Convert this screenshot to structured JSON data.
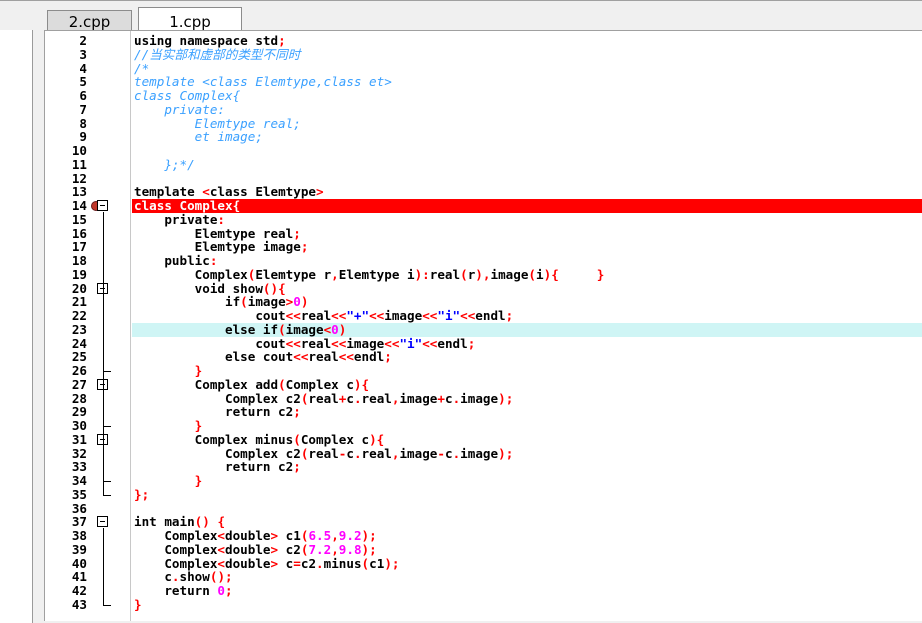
{
  "tabs": [
    {
      "label": "2.cpp",
      "active": false
    },
    {
      "label": "1.cpp",
      "active": true
    }
  ],
  "colors": {
    "error_line": "#ff0000",
    "current_line": "#cff5f5",
    "comment": "#3aa0ff",
    "operator": "#ff0000",
    "string": "#0000ff",
    "number": "#ff00ff"
  },
  "lines": [
    {
      "n": "2",
      "code": "using namespace std;"
    },
    {
      "n": "3",
      "code": "//当实部和虚部的类型不同时"
    },
    {
      "n": "4",
      "code": "/*"
    },
    {
      "n": "5",
      "code": "template <class Elemtype,class et>"
    },
    {
      "n": "6",
      "code": "class Complex{"
    },
    {
      "n": "7",
      "code": "    private:"
    },
    {
      "n": "8",
      "code": "        Elemtype real;"
    },
    {
      "n": "9",
      "code": "        et image;"
    },
    {
      "n": "10",
      "code": ""
    },
    {
      "n": "11",
      "code": "    };*/"
    },
    {
      "n": "12",
      "code": ""
    },
    {
      "n": "13",
      "code": "template <class Elemtype>"
    },
    {
      "n": "14",
      "code": "class Complex{"
    },
    {
      "n": "15",
      "code": "    private:"
    },
    {
      "n": "16",
      "code": "        Elemtype real;"
    },
    {
      "n": "17",
      "code": "        Elemtype image;"
    },
    {
      "n": "18",
      "code": "    public:"
    },
    {
      "n": "19",
      "code": "        Complex(Elemtype r,Elemtype i):real(r),image(i){     }"
    },
    {
      "n": "20",
      "code": "        void show(){"
    },
    {
      "n": "21",
      "code": "            if(image>0)"
    },
    {
      "n": "22",
      "code": "                cout<<real<<\"+\"<<image<<\"i\"<<endl;"
    },
    {
      "n": "23",
      "code": "            else if(image<0)"
    },
    {
      "n": "24",
      "code": "                cout<<real<<image<<\"i\"<<endl;"
    },
    {
      "n": "25",
      "code": "            else cout<<real<<endl;"
    },
    {
      "n": "26",
      "code": "        }"
    },
    {
      "n": "27",
      "code": "        Complex add(Complex c){"
    },
    {
      "n": "28",
      "code": "            Complex c2(real+c.real,image+c.image);"
    },
    {
      "n": "29",
      "code": "            return c2;"
    },
    {
      "n": "30",
      "code": "        }"
    },
    {
      "n": "31",
      "code": "        Complex minus(Complex c){"
    },
    {
      "n": "32",
      "code": "            Complex c2(real-c.real,image-c.image);"
    },
    {
      "n": "33",
      "code": "            return c2;"
    },
    {
      "n": "34",
      "code": "        }"
    },
    {
      "n": "35",
      "code": "};"
    },
    {
      "n": "36",
      "code": ""
    },
    {
      "n": "37",
      "code": "int main() {"
    },
    {
      "n": "38",
      "code": "    Complex<double> c1(6.5,9.2);"
    },
    {
      "n": "39",
      "code": "    Complex<double> c2(7.2,9.8);"
    },
    {
      "n": "40",
      "code": "    Complex<double> c=c2.minus(c1);"
    },
    {
      "n": "41",
      "code": "    c.show();"
    },
    {
      "n": "42",
      "code": "    return 0;"
    },
    {
      "n": "43",
      "code": "}"
    }
  ]
}
